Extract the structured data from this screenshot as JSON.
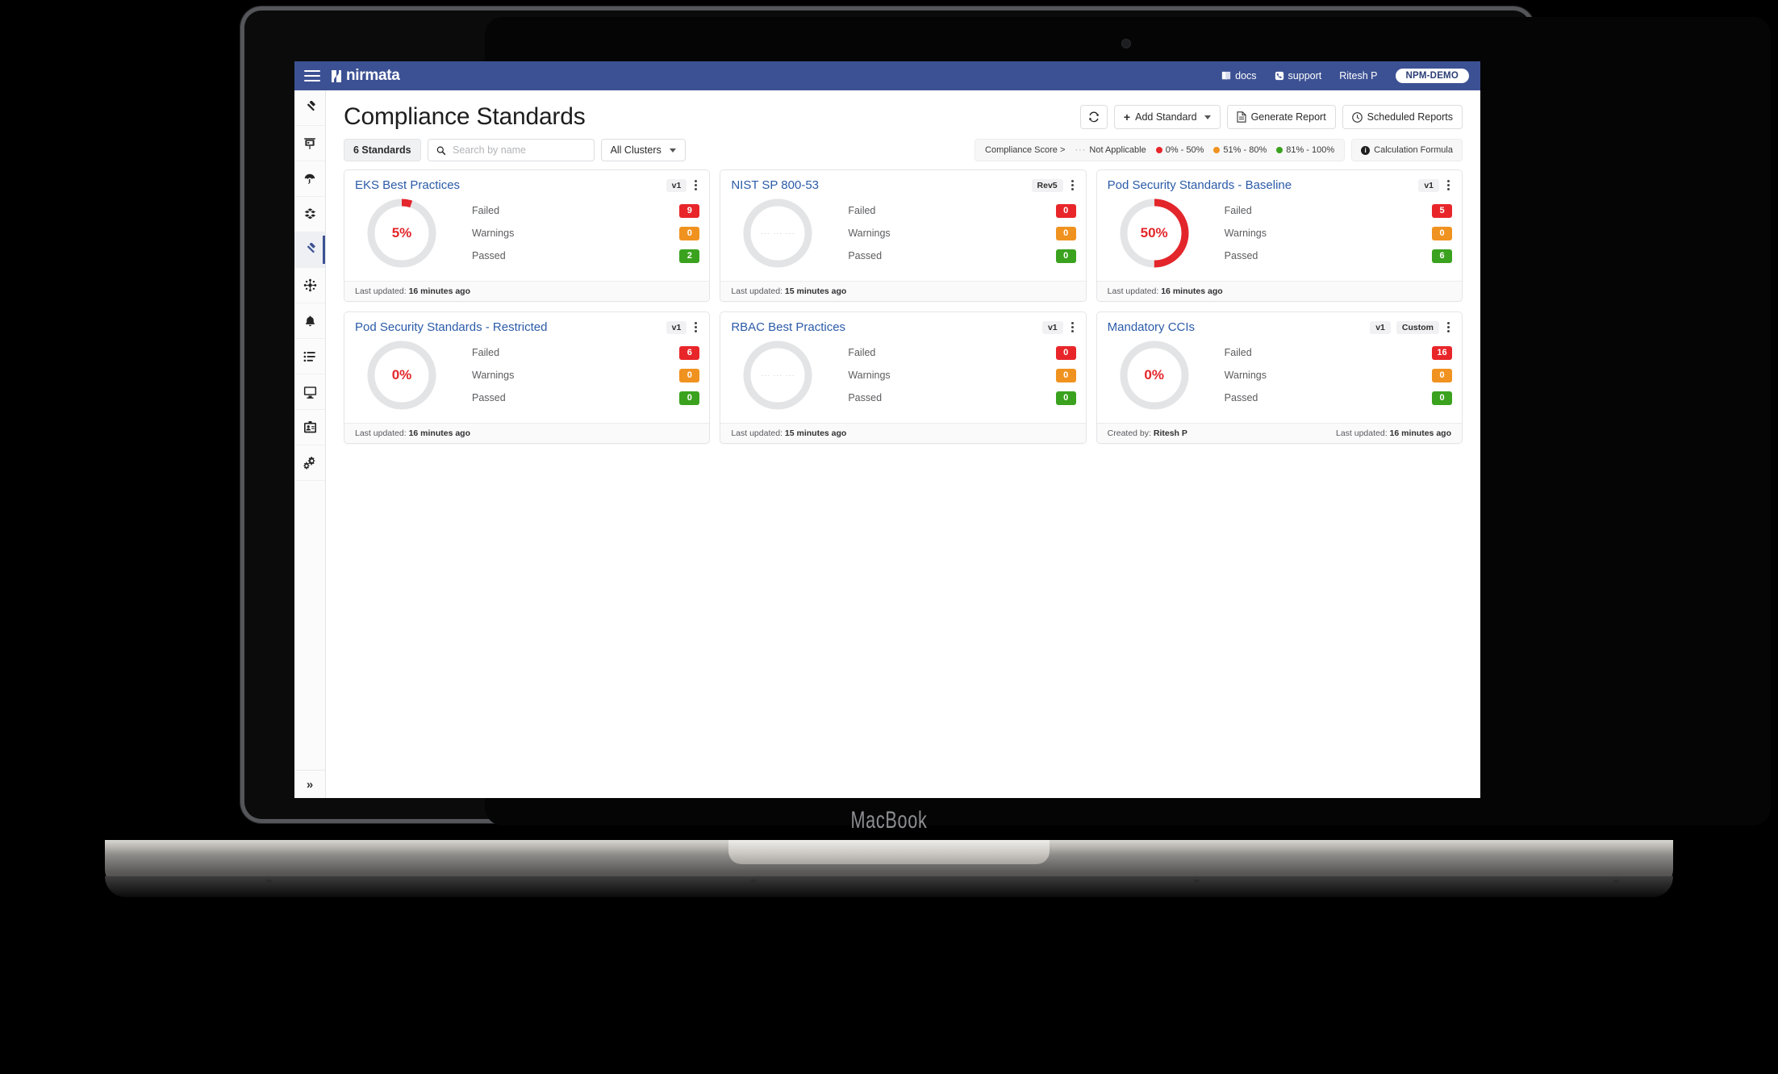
{
  "device": {
    "label": "MacBook"
  },
  "topnav": {
    "menu_icon": "hamburger-icon",
    "brand": "nirmata",
    "docs": "docs",
    "support": "support",
    "user": "Ritesh P",
    "org": "NPM-DEMO"
  },
  "sidebar": {
    "items": [
      {
        "name": "policies",
        "icon": "gavel-icon",
        "active": false
      },
      {
        "name": "dashboards",
        "icon": "presentation-icon",
        "active": false
      },
      {
        "name": "protect",
        "icon": "umbrella-icon",
        "active": false
      },
      {
        "name": "resources",
        "icon": "cubes-icon",
        "active": false
      },
      {
        "name": "compliance",
        "icon": "gavel-icon",
        "active": true
      },
      {
        "name": "topology",
        "icon": "network-share-icon",
        "active": false
      },
      {
        "name": "alerts",
        "icon": "bell-icon",
        "active": false
      },
      {
        "name": "reports-list",
        "icon": "list-icon",
        "active": false
      },
      {
        "name": "clusters",
        "icon": "monitor-icon",
        "active": false
      },
      {
        "name": "accounts",
        "icon": "id-badge-icon",
        "active": false
      },
      {
        "name": "settings",
        "icon": "gears-icon",
        "active": false
      }
    ],
    "expand_glyph": "»"
  },
  "header": {
    "title": "Compliance Standards",
    "refresh_label": "⟳",
    "add_standard": "Add Standard",
    "generate_report": "Generate Report",
    "scheduled_reports": "Scheduled Reports"
  },
  "filters": {
    "count_pill": "6 Standards",
    "search_placeholder": "Search by name",
    "search_value": "",
    "cluster_select": "All Clusters",
    "legend_title": "Compliance Score >",
    "legend_na_dash": "···",
    "legend_na": "Not Applicable",
    "legend_items": [
      {
        "label": "0% - 50%",
        "color": "#e8262a"
      },
      {
        "label": "51% - 80%",
        "color": "#f0921f"
      },
      {
        "label": "81% - 100%",
        "color": "#3aa21e"
      }
    ],
    "formula_button": "Calculation Formula"
  },
  "stat_labels": {
    "failed": "Failed",
    "warnings": "Warnings",
    "passed": "Passed"
  },
  "colors": {
    "brand_blue": "#3c5193",
    "link_blue": "#2b5ba8",
    "failed": "#e8262a",
    "warnings": "#f0921f",
    "passed": "#3aa21e",
    "track": "#e3e4e6"
  },
  "labels": {
    "last_updated": "Last updated:",
    "created_by": "Created by:"
  },
  "chart_data": {
    "type": "pie",
    "title": "Compliance Standards — compliance score donuts",
    "legend": [
      "0% - 50%",
      "51% - 80%",
      "81% - 100%",
      "Not Applicable"
    ],
    "series": [
      {
        "name": "EKS Best Practices",
        "value": 5,
        "unit": "%",
        "arc_color": "#e8262a"
      },
      {
        "name": "NIST SP 800-53",
        "value": null,
        "unit": "%",
        "arc_color": null
      },
      {
        "name": "Pod Security Standards - Baseline",
        "value": 50,
        "unit": "%",
        "arc_color": "#e3262b"
      },
      {
        "name": "Pod Security Standards - Restricted",
        "value": 0,
        "unit": "%",
        "arc_color": null
      },
      {
        "name": "RBAC Best Practices",
        "value": null,
        "unit": "%",
        "arc_color": null
      },
      {
        "name": "Mandatory CCIs",
        "value": 0,
        "unit": "%",
        "arc_color": null
      }
    ]
  },
  "cards": [
    {
      "title": "EKS Best Practices",
      "version": "v1",
      "custom": null,
      "score_text": "5%",
      "not_applicable": false,
      "percent": 5,
      "failed": "9",
      "warnings": "0",
      "passed": "2",
      "last_updated": "16 minutes ago",
      "created_by": null
    },
    {
      "title": "NIST SP 800-53",
      "version": "Rev5",
      "custom": null,
      "score_text": "··· ··· ···",
      "not_applicable": true,
      "percent": 0,
      "failed": "0",
      "warnings": "0",
      "passed": "0",
      "last_updated": "15 minutes ago",
      "created_by": null
    },
    {
      "title": "Pod Security Standards - Baseline",
      "version": "v1",
      "custom": null,
      "score_text": "50%",
      "not_applicable": false,
      "percent": 50,
      "failed": "5",
      "warnings": "0",
      "passed": "6",
      "last_updated": "16 minutes ago",
      "created_by": null
    },
    {
      "title": "Pod Security Standards - Restricted",
      "version": "v1",
      "custom": null,
      "score_text": "0%",
      "not_applicable": false,
      "percent": 0,
      "failed": "6",
      "warnings": "0",
      "passed": "0",
      "last_updated": "16 minutes ago",
      "created_by": null
    },
    {
      "title": "RBAC Best Practices",
      "version": "v1",
      "custom": null,
      "score_text": "··· ··· ···",
      "not_applicable": true,
      "percent": 0,
      "failed": "0",
      "warnings": "0",
      "passed": "0",
      "last_updated": "15 minutes ago",
      "created_by": null
    },
    {
      "title": "Mandatory CCIs",
      "version": "v1",
      "custom": "Custom",
      "score_text": "0%",
      "not_applicable": false,
      "percent": 0,
      "failed": "16",
      "warnings": "0",
      "passed": "0",
      "last_updated": "16 minutes ago",
      "created_by": "Ritesh P"
    }
  ]
}
